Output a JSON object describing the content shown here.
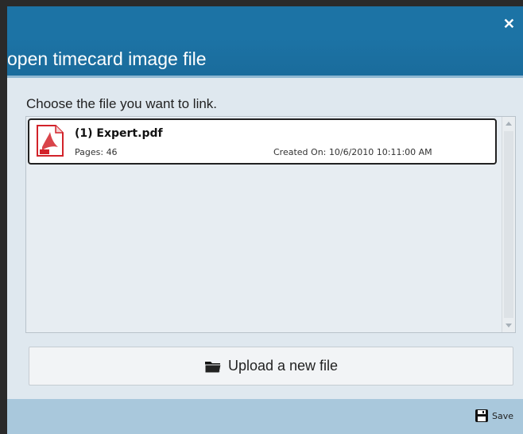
{
  "dialog": {
    "title": "open timecard image file",
    "close_glyph": "✕",
    "instruction": "Choose the file you want to link."
  },
  "file_list": {
    "items": [
      {
        "icon": "pdf-file-icon",
        "name": "(1) Expert.pdf",
        "pages_text": "Pages: 46",
        "created_text": "Created On: 10/6/2010 10:11:00 AM"
      }
    ]
  },
  "upload": {
    "icon": "folder-icon",
    "label": "Upload a new file"
  },
  "footer": {
    "save_icon": "floppy-disk-icon",
    "save_label": "Save"
  },
  "colors": {
    "header": "#1c73a5",
    "footer": "#a9c8dc",
    "body": "#dfe8ef",
    "pdf_red": "#d2232a"
  }
}
